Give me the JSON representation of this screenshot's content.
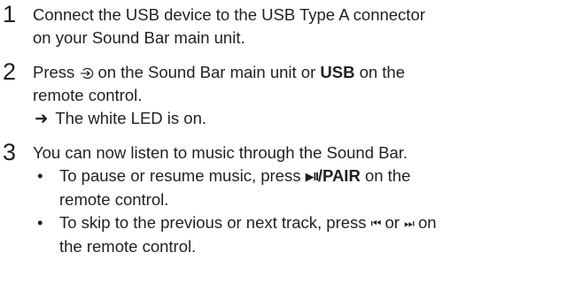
{
  "steps": [
    {
      "number": "1",
      "lines": [
        "Connect the USB device to the USB Type A connector",
        "on your Sound Bar main unit."
      ]
    },
    {
      "number": "2",
      "line1_pre": "Press",
      "line1_mid": "on the Sound Bar main unit or",
      "line1_bold": "USB",
      "line1_post": "on the",
      "line2": "remote control.",
      "result_arrow": "➜",
      "result_text": "The white LED is on.",
      "source_icon": "source-input-icon"
    },
    {
      "number": "3",
      "intro": "You can now listen to music through the Sound Bar.",
      "bullets": [
        {
          "dot": "•",
          "pre": "To pause or resume music, press",
          "play_symbol": "▶II",
          "bold": "/PAIR",
          "post": "on the",
          "line2": "remote control."
        },
        {
          "dot": "•",
          "pre": "To skip to the previous or next track, press",
          "prev_symbol": "⏮",
          "mid": "or",
          "next_symbol": "⏭",
          "post": "on",
          "line2": "the remote control."
        }
      ]
    }
  ]
}
